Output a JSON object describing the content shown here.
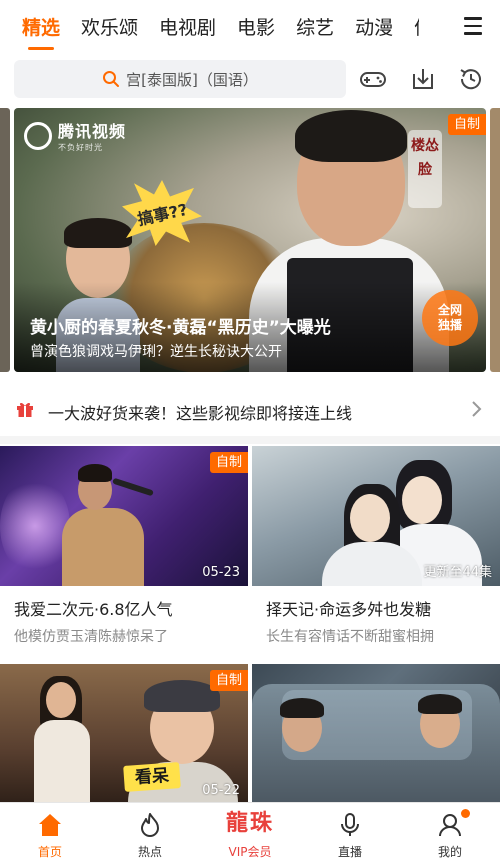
{
  "top_tabs": {
    "items": [
      "精选",
      "欢乐颂",
      "电视剧",
      "电影",
      "综艺",
      "动漫",
      "体"
    ],
    "active_index": 0,
    "menu_icon": "hamburger-menu-icon"
  },
  "search": {
    "text": "宫[泰国版]（国语）",
    "search_icon": "search-icon",
    "actions": [
      "gamepad-icon",
      "download-icon",
      "history-icon"
    ]
  },
  "hero": {
    "logo_text": "腾讯视频",
    "logo_sub": "不负好时光",
    "badge": "自制",
    "starburst": "搞事??",
    "stamp": "楼怂脸",
    "exclusive": [
      "全网",
      "独播"
    ],
    "title": "黄小厨的春夏秋冬·黄磊“黑历史”大曝光",
    "subtitle": "曾演色狼调戏马伊琍？逆生长秘诀大公开"
  },
  "notice": {
    "text": "一大波好货来袭！这些影视综即将接连上线",
    "gift_icon": "gift-icon",
    "chevron_icon": "chevron-right-icon"
  },
  "cards": [
    {
      "title": "我爱二次元·6.8亿人气",
      "desc": "他模仿贾玉清陈赫惊呆了",
      "badge": "自制",
      "stamp": "05-23"
    },
    {
      "title": "择天记·命运多舛也发糖",
      "desc": "长生有容情话不断甜蜜相拥",
      "badge": "",
      "stamp": "更新至44集"
    },
    {
      "title": "",
      "desc": "",
      "badge": "自制",
      "stamp": "05-22",
      "caption": "看呆"
    },
    {
      "title": "",
      "desc": "",
      "badge": "",
      "stamp": ""
    }
  ],
  "bottom_nav": {
    "items": [
      {
        "label": "首页",
        "icon": "home-icon",
        "active": true
      },
      {
        "label": "热点",
        "icon": "flame-icon",
        "active": false
      },
      {
        "label": "VIP会员",
        "logo": "龍珠",
        "icon": "vip-logo",
        "active": false
      },
      {
        "label": "直播",
        "icon": "microphone-icon",
        "active": false
      },
      {
        "label": "我的",
        "icon": "user-icon",
        "active": false
      }
    ]
  },
  "colors": {
    "accent": "#ff6a00",
    "vip": "#e8413c",
    "text": "#222222",
    "muted": "#8a8a8a"
  }
}
